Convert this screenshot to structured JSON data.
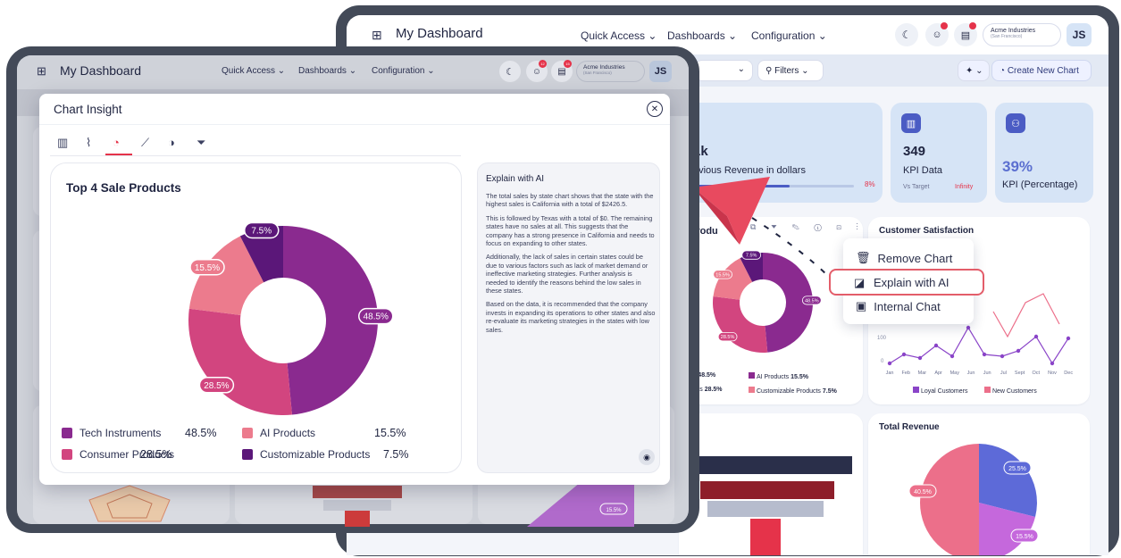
{
  "back": {
    "app_title": "My Dashboard",
    "nav": [
      "Quick Access",
      "Dashboards",
      "Configuration"
    ],
    "company": "Acme Industries",
    "company_sub": "(San Francisco)",
    "avatar": "JS",
    "filters_label": "Filters",
    "create_chart_label": "Create New Chart",
    "kpi_revenue": {
      "value": "1k",
      "label": "evious Revenue in dollars",
      "pct": "8%",
      "progress": 0.6
    },
    "kpi_data": {
      "value": "349",
      "label": "KPI Data",
      "sub_left": "Vs Target",
      "sub_right": "Infinity"
    },
    "kpi_percentage": {
      "value": "39%",
      "label": "KPI (Percentage)"
    },
    "donut_card_title": "Produ",
    "donut_labels": [
      "7.5%",
      "15.5%",
      "28.5%",
      "48.5%"
    ],
    "donut_legend": [
      {
        "name": "nts",
        "value": "48.5%"
      },
      {
        "name": "AI Products",
        "value": "15.5%"
      },
      {
        "name": "ducts",
        "value": "28.5%"
      },
      {
        "name": "Customizable Products",
        "value": "7.5%"
      }
    ],
    "context_menu": [
      "Remove Chart",
      "Explain with AI",
      "Internal Chat"
    ],
    "customer_satisfaction": {
      "title": "Customer Satisfaction",
      "y_ticks": [
        "100",
        "0"
      ],
      "months": [
        "Jan",
        "Feb",
        "Mar",
        "Apr",
        "May",
        "Jun",
        "Jun",
        "Jul",
        "Sept",
        "Oct",
        "Nov",
        "Dec"
      ],
      "legend": [
        "Loyal Customers",
        "New Customers"
      ]
    },
    "total_revenue": {
      "title": "Total Revenue",
      "labels": [
        "25.5%",
        "40.5%",
        "15.5%"
      ]
    },
    "funnel_pie_label": "15.5%"
  },
  "front": {
    "app_title": "My Dashboard",
    "nav": [
      "Quick Access",
      "Dashboards",
      "Configuration"
    ],
    "company": "Acme Industries",
    "company_sub": "(San Francisco)",
    "avatar": "JS",
    "badges": [
      "12",
      "15"
    ],
    "modal_title": "Chart Insight",
    "chart_title": "Top 4 Sale Products",
    "ai_title": "Explain with AI",
    "ai_paragraphs": [
      "The total sales by state chart shows that the state with the highest sales is California with a total of $2426.5.",
      "This is followed by Texas with a total of $0. The remaining states have no sales at all. This suggests that the company has a strong presence in California and needs to focus on expanding to other states.",
      "Additionally, the lack of sales in certain states could be due to various factors such as lack of market demand or ineffective marketing strategies. Further analysis is needed to identify the reasons behind the low sales in these states.",
      "Based on the data, it is recommended that the company invests in expanding its operations to other states and also re-evaluate its marketing strategies in the states with low sales."
    ]
  },
  "chart_data": {
    "type": "pie",
    "title": "Top 4 Sale Products",
    "categories": [
      "Tech Instruments",
      "Consumer Products",
      "AI Products",
      "Customizable Products"
    ],
    "values": [
      48.5,
      28.5,
      15.5,
      7.5
    ],
    "labels": [
      "48.5%",
      "28.5%",
      "15.5%",
      "7.5%"
    ],
    "colors": [
      "#8a2a8f",
      "#d2457f",
      "#ec7b8d",
      "#5b1779"
    ],
    "legend": "bottom"
  }
}
